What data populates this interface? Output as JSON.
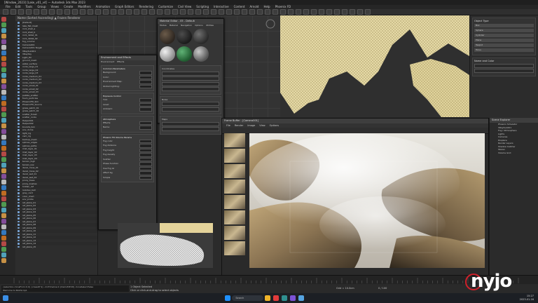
{
  "app": {
    "title": "[Window_2023] [Lake_v01_v4] — Autodesk 3ds Max 2023",
    "menus": [
      "File",
      "Edit",
      "Tools",
      "Group",
      "Views",
      "Create",
      "Modifiers",
      "Animation",
      "Graph Editors",
      "Rendering",
      "Customize",
      "Civil View",
      "Scripting",
      "Interactive",
      "Content",
      "Arnold",
      "Help",
      "Phoenix FD"
    ]
  },
  "scene_explorer": {
    "header": "Name (Sorted Ascending)  ▲  Frozen   Renderer",
    "rows": [
      "[Default]",
      "  lake_flat_mesh",
      "  rock_shell_a",
      "  rock_shell_b",
      "  rock_detail_01",
      "  rock_detail_02",
      "  fog_volume",
      "  Camera001",
      "  Camera001.Target",
      "  VRaySun001",
      "  VRaySky",
      "  Light_fill",
      "  ground_mesh",
      "  water_surface",
      "  rocks_large_01",
      "  rocks_large_02",
      "  rocks_large_03",
      "  rocks_medium_01",
      "  rocks_medium_02",
      "  rocks_medium_03",
      "  rocks_small_01",
      "  rocks_small_02",
      "  rocks_small_03",
      "  pebble_scatter",
      "  foam_particles",
      "  PhoenixFD_Sim",
      "  PhoenixFD_Source",
      "  grass_patch_01",
      "  grass_patch_02",
      "  scatter_forest",
      "  scatter_rocks",
      "  Helper001",
      "  Helper002",
      "  bounds_box",
      "  env_dome",
      "  light_rig",
      "  cam_rig",
      "  backup_mesh",
      "  splines_edges",
      "  splines_paths",
      "  mist_layer_01",
      "  mist_layer_02",
      "  mist_layer_03",
      "  mist_layer_04",
      "  terrain_high",
      "  terrain_low",
      "  decal_moss_01",
      "  decal_moss_02",
      "  decal_wet_01",
      "  decal_wet_02",
      "  proxy_trees",
      "  proxy_bushes",
      "  hidden_ref",
      "  lookdev_ball",
      "  grey_card",
      "  color_chart",
      "  env_probe",
      "  ref_plane_01",
      "  ref_plane_02",
      "  ref_plane_03",
      "  ref_plane_04",
      "  ref_plane_05",
      "  ref_plane_06",
      "  ref_plane_07",
      "  ref_plane_08",
      "  ref_plane_09",
      "  ref_plane_10",
      "  ref_plane_11",
      "  ref_plane_12",
      "  ref_plane_13",
      "  ref_plane_14",
      "  ref_plane_15"
    ]
  },
  "material_editor": {
    "title": "Material Editor - 05 - Default",
    "menus": [
      "Modes",
      "Material",
      "Navigation",
      "Options",
      "Utilities"
    ],
    "rollouts": [
      "Coordinates",
      "Noise",
      "Maps"
    ]
  },
  "env_dialog": {
    "title": "Environment and Effects",
    "tabs": [
      "Environment",
      "Effects"
    ],
    "rollouts": [
      "Common Parameters",
      "Exposure Control",
      "Atmosphere",
      "Phoenix FD Volume Params"
    ],
    "labels": [
      "Background:",
      "Color:",
      "Environment Map:",
      "Global Lighting:",
      "Tint:",
      "Level:",
      "Ambient:",
      "Effects:",
      "Name:",
      "Fog color",
      "Fog distance",
      "Fog height",
      "Fog density",
      "Scatter",
      "Phase function",
      "Use Fog GI",
      "Affect bg",
      "Simple"
    ]
  },
  "render_window": {
    "title": "Frame Buffer - [Camera001]",
    "menus": [
      "File",
      "Render",
      "Image",
      "View",
      "Options"
    ]
  },
  "right_panel": {
    "title": "Scene Explorer",
    "items": [
      "Phoenix Simulator",
      "VRaySun001",
      "Fog / Atmosphere",
      "Lights",
      "Cameras",
      "Displace",
      "Render Layers",
      "Shadow Catcher",
      "Stereo",
      "Volume Grid"
    ]
  },
  "command_panel": {
    "sections": [
      "Object Type",
      "Name and Color"
    ],
    "buttons": [
      "Box",
      "Sphere",
      "Cylinder",
      "Plane",
      "Teapot",
      "Torus"
    ]
  },
  "maxscript": {
    "line1": "{selection.cloneFrom:0.0} {classOf $} -mnTimeline:0 {itemsToEdit} cloneSelect:false",
    "line2": "Welcome to MAXScript."
  },
  "status": {
    "selection": "1 Object Selected",
    "prompt": "Click or click-and-drag to select objects",
    "grid": "Grid = 10.0cm",
    "frame": "0 / 100"
  },
  "taskbar": {
    "search": "Search",
    "time": "15:27",
    "date": "2023-01-16"
  },
  "logo": {
    "text": "nyjo"
  }
}
